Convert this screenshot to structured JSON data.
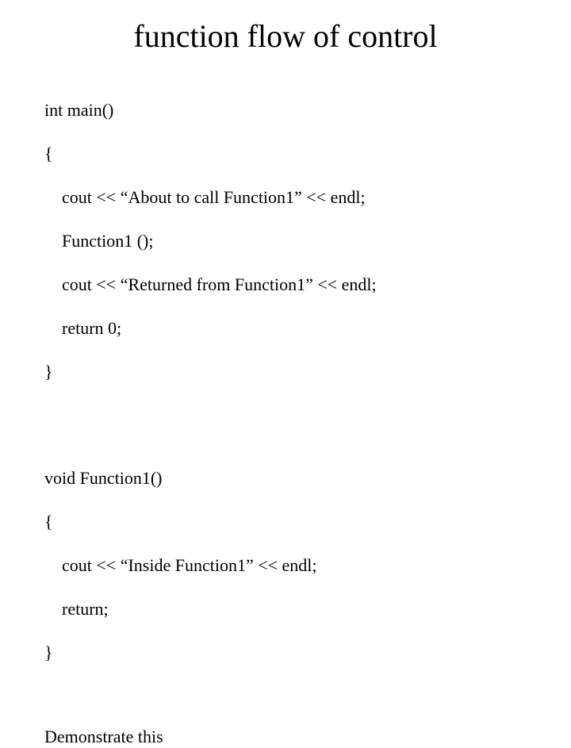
{
  "title": "function flow of control",
  "main_func": {
    "sig": "int main()",
    "open": "{",
    "l1": "cout << “About to call Function1” << endl;",
    "l2": "Function1 ();",
    "l3": "cout << “Returned from Function1” << endl;",
    "l4": "return 0;",
    "close": "}"
  },
  "func1": {
    "sig": "void Function1()",
    "open": "{",
    "l1": "cout << “Inside Function1” << endl;",
    "l2": "return;",
    "close": "}"
  },
  "footer": "Demonstrate this"
}
